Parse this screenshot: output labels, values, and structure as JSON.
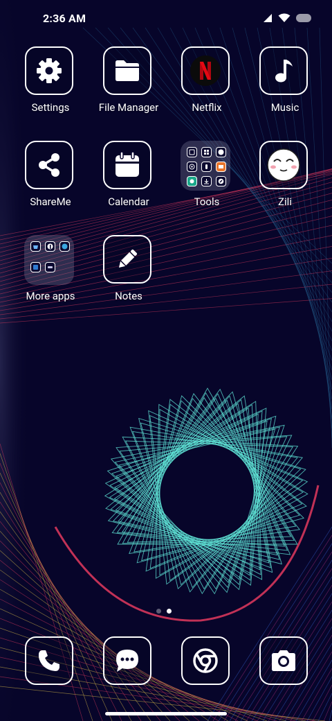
{
  "status_bar": {
    "time": "2:36 AM"
  },
  "apps": [
    {
      "label": "Settings"
    },
    {
      "label": "File Manager"
    },
    {
      "label": "Netflix"
    },
    {
      "label": "Music"
    },
    {
      "label": "ShareMe"
    },
    {
      "label": "Calendar"
    },
    {
      "label": "Tools"
    },
    {
      "label": "Zili"
    },
    {
      "label": "More apps"
    },
    {
      "label": "Notes"
    }
  ],
  "dock": [
    {
      "icon": "phone-icon"
    },
    {
      "icon": "messages-icon"
    },
    {
      "icon": "chrome-icon"
    },
    {
      "icon": "camera-icon"
    }
  ],
  "page_indicator": {
    "pages": 2,
    "current": 2
  },
  "colors": {
    "background": "#07052a",
    "spiral": "#5fe3d6",
    "red_lines": "#e23a5e",
    "yellow_lines": "#e8c84a",
    "blue_lines": "#3b6be0",
    "netflix_red": "#e50914"
  }
}
